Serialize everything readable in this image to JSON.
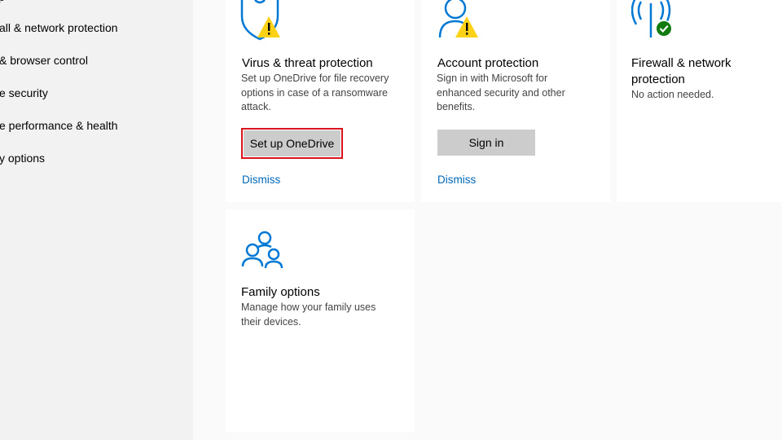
{
  "sidebar": {
    "items": [
      {
        "label": "p"
      },
      {
        "label": "all & network protection"
      },
      {
        "label": "& browser control"
      },
      {
        "label": "e security"
      },
      {
        "label": "e performance & health"
      },
      {
        "label": "y options"
      }
    ]
  },
  "cards": {
    "virus": {
      "title": "Virus & threat protection",
      "description": "Set up OneDrive for file recovery options in case of a ransomware attack.",
      "button_label": "Set up OneDrive",
      "dismiss_label": "Dismiss",
      "icon": "shield-warning-icon"
    },
    "account": {
      "title": "Account protection",
      "description": "Sign in with Microsoft for enhanced security and other benefits.",
      "button_label": "Sign in",
      "dismiss_label": "Dismiss",
      "icon": "person-warning-icon"
    },
    "firewall": {
      "title": "Firewall & network protection",
      "description": "No action needed.",
      "icon": "antenna-check-icon"
    },
    "family": {
      "title": "Family options",
      "description": "Manage how your family uses their devices.",
      "icon": "family-icon"
    }
  },
  "colors": {
    "accent": "#0067b8",
    "icon_blue": "#0078d4",
    "warning": "#fcd116",
    "ok": "#107c10",
    "focus": "#d9141f"
  }
}
